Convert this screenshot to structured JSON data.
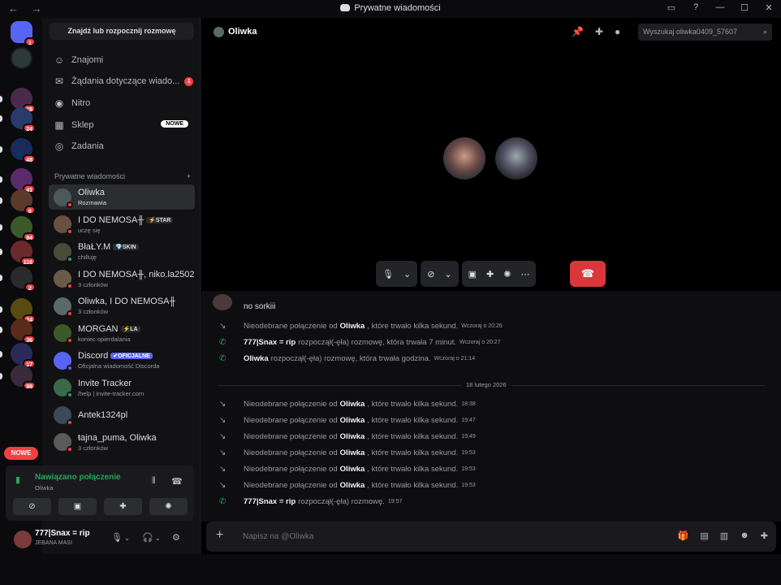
{
  "window": {
    "title": "Prywatne wiadomości",
    "nav_icons": "← →"
  },
  "servers": {
    "badges": [
      "1",
      "28",
      "24",
      "48",
      "41",
      "6",
      "94",
      "116",
      "2",
      "24",
      "36",
      "17",
      "98"
    ],
    "nowe_label": "NOWE"
  },
  "sidebar": {
    "search_label": "Znajdź lub rozpocznij rozmowę",
    "nav": [
      {
        "label": "Znajomi",
        "icon": "friends-icon"
      },
      {
        "label": "Żądania dotyczące wiado...",
        "icon": "mail-icon",
        "badge": "1"
      },
      {
        "label": "Nitro",
        "icon": "nitro-icon"
      },
      {
        "label": "Sklep",
        "icon": "shop-icon",
        "badge": "NOWE"
      },
      {
        "label": "Zadania",
        "icon": "quests-icon"
      }
    ],
    "section_title": "Prywatne wiadomości",
    "section_add": "+",
    "dms": [
      {
        "name": "Oliwka",
        "sub": "Rozmawia"
      },
      {
        "name": "I DO NEMOSA╫",
        "tag": "⚡STAR",
        "sub": "uczę się"
      },
      {
        "name": "BłaŁY.M",
        "tag": "💎SKIN",
        "sub": "chilluję"
      },
      {
        "name": "I DO NEMOSA╫, niko.la2502",
        "sub": "3 członków"
      },
      {
        "name": "Oliwka, I DO NEMOSA╫",
        "sub": "3 członków"
      },
      {
        "name": "MORGAN",
        "tag": "⚡LA",
        "sub": "koniec opierdalania"
      },
      {
        "name": "Discord",
        "tag": "✔OFICJALNE",
        "sub": "Oficjalna wiadomość Discorda"
      },
      {
        "name": "Invite Tracker",
        "sub": "/help | invite-tracker.com"
      },
      {
        "name": "Antek1324pl",
        "sub": ""
      },
      {
        "name": "ŧajna_puma, Oliwka",
        "sub": "3 członków"
      }
    ]
  },
  "voice": {
    "status": "Nawiązano połączenie",
    "channel": "Oliwka"
  },
  "user": {
    "name": "777|Snax = rip",
    "status": "JEBANA MASI"
  },
  "header": {
    "title": "Oliwka",
    "search_placeholder": "Wyszukaj oliwka0409_57607"
  },
  "chat": {
    "partial_message": "no sorkiii",
    "messages_before": [
      {
        "type": "missed",
        "pre": "Nieodebrane połączenie od",
        "name": "Oliwka",
        "post": ", które trwało kilka sekund.",
        "time": "Wczoraj o 20:26"
      },
      {
        "type": "call",
        "pre": "",
        "name": "777|Snax = rip",
        "post": "rozpoczął(-ęła) rozmowę, która trwała 7 minut.",
        "time": "Wczoraj o 20:27"
      },
      {
        "type": "call",
        "pre": "",
        "name": "Oliwka",
        "post": "rozpoczął(-ęła) rozmowę, która trwała godzina.",
        "time": "Wczoraj o 21:14"
      }
    ],
    "date_divider": "18 lutego 2026",
    "messages_after": [
      {
        "type": "missed",
        "pre": "Nieodebrane połączenie od",
        "name": "Oliwka",
        "post": ", które trwało kilka sekund.",
        "time": "18:38"
      },
      {
        "type": "missed",
        "pre": "Nieodebrane połączenie od",
        "name": "Oliwka",
        "post": ", które trwało kilka sekund.",
        "time": "19:47"
      },
      {
        "type": "missed",
        "pre": "Nieodebrane połączenie od",
        "name": "Oliwka",
        "post": ", które trwało kilka sekund.",
        "time": "19:49"
      },
      {
        "type": "missed",
        "pre": "Nieodebrane połączenie od",
        "name": "Oliwka",
        "post": ", które trwało kilka sekund.",
        "time": "19:53"
      },
      {
        "type": "missed",
        "pre": "Nieodebrane połączenie od",
        "name": "Oliwka",
        "post": ", które trwało kilka sekund.",
        "time": "19:53"
      },
      {
        "type": "missed",
        "pre": "Nieodebrane połączenie od",
        "name": "Oliwka",
        "post": ", które trwało kilka sekund.",
        "time": "19:53"
      },
      {
        "type": "call",
        "pre": "",
        "name": "777|Snax = rip",
        "post": "rozpoczął(-ęła) rozmowę.",
        "time": "19:57"
      }
    ]
  },
  "composer": {
    "placeholder": "Napisz na @Oliwka"
  },
  "colors": {
    "accent_green": "#23a55a",
    "danger": "#da373c",
    "brand": "#5865f2"
  }
}
